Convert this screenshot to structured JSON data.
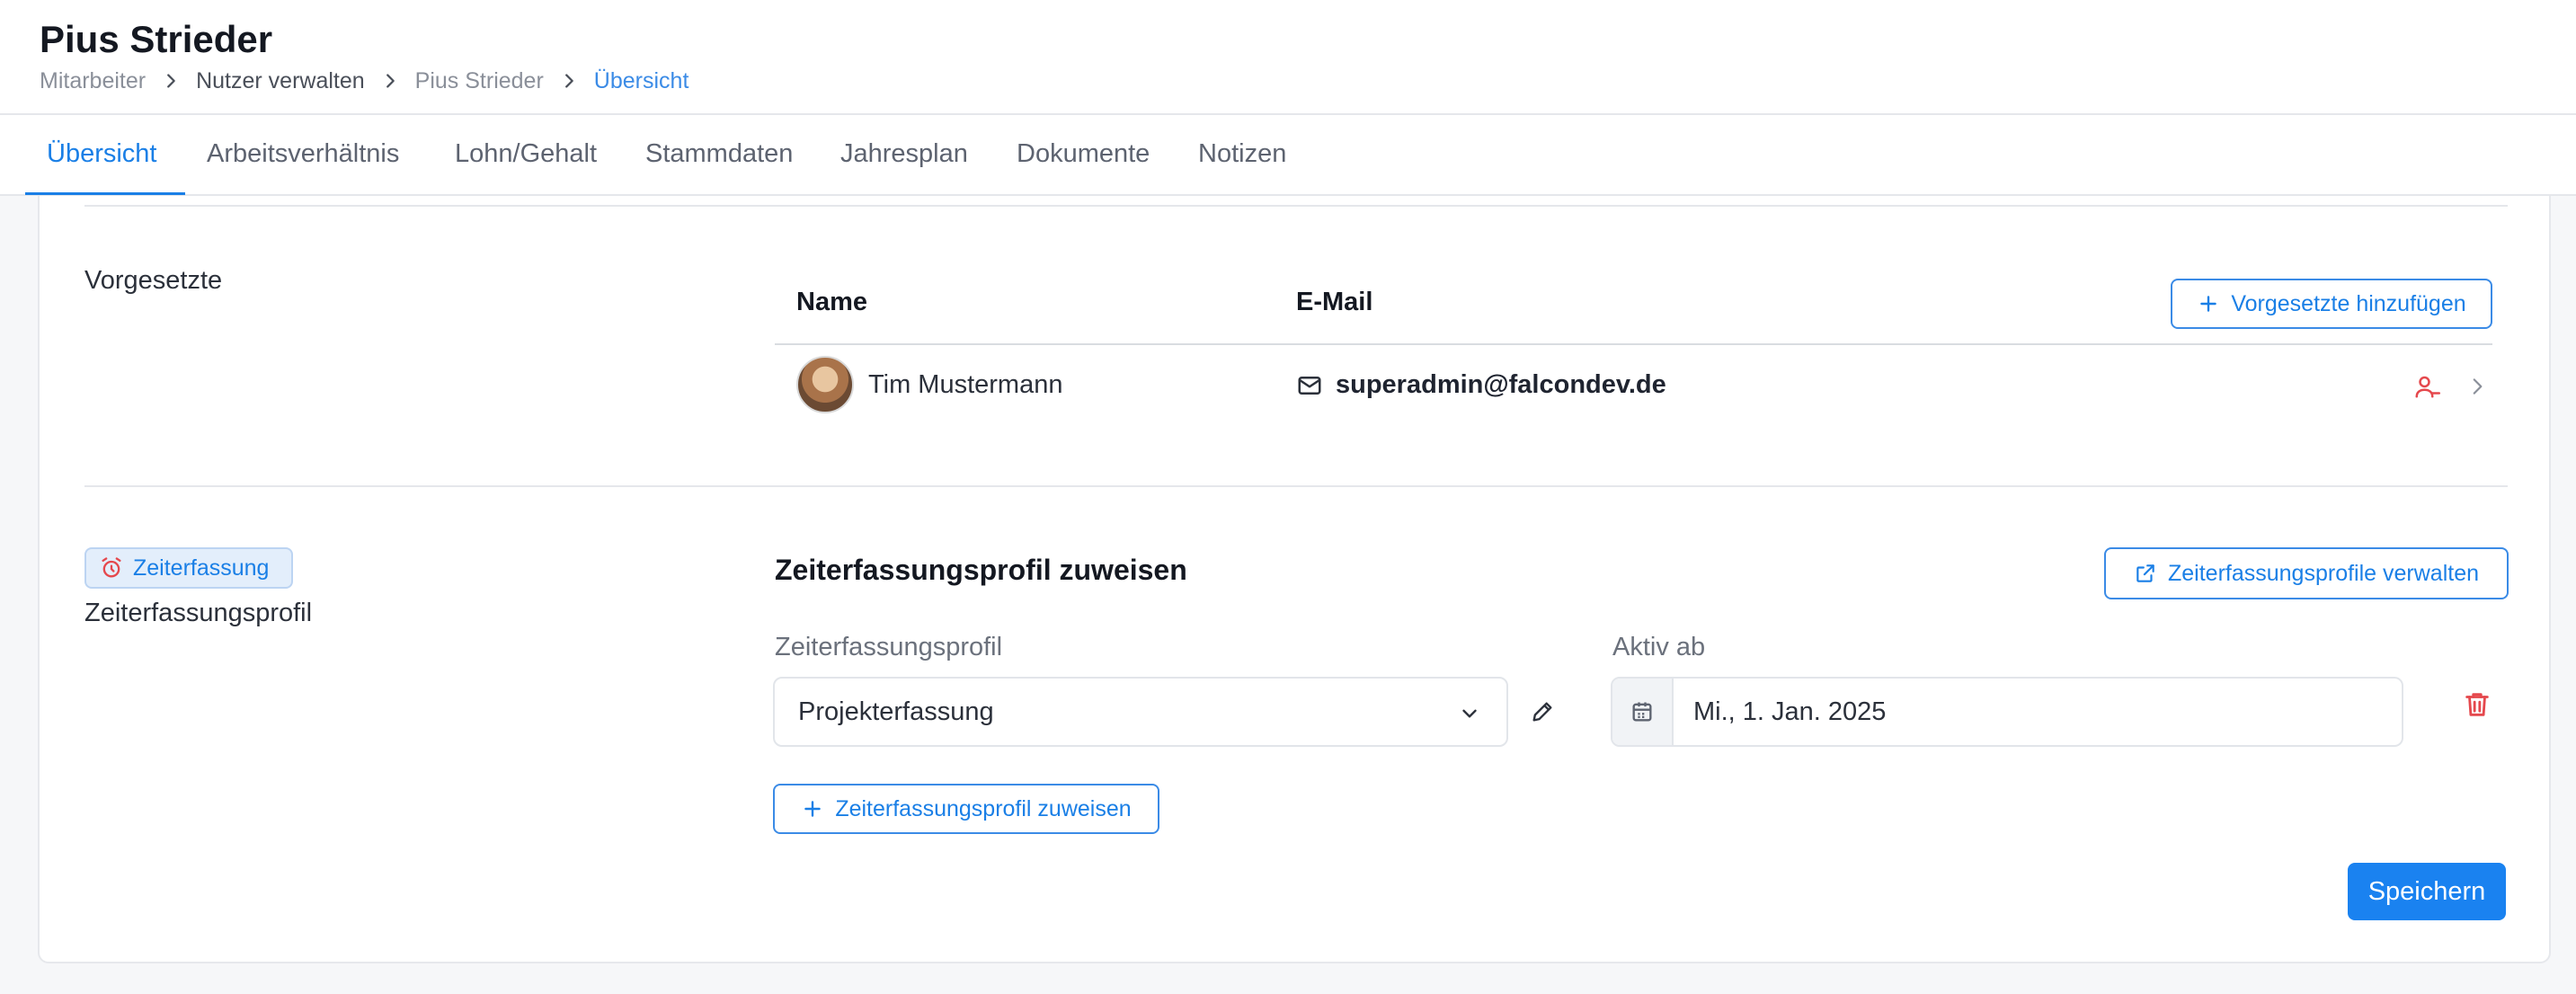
{
  "header": {
    "title": "Pius Strieder",
    "breadcrumb": [
      "Mitarbeiter",
      "Nutzer verwalten",
      "Pius Strieder",
      "Übersicht"
    ]
  },
  "tabs": [
    {
      "label": "Übersicht",
      "active": true
    },
    {
      "label": "Arbeitsverhältnis"
    },
    {
      "label": "Lohn/Gehalt"
    },
    {
      "label": "Stammdaten"
    },
    {
      "label": "Jahresplan"
    },
    {
      "label": "Dokumente"
    },
    {
      "label": "Notizen"
    }
  ],
  "supervisors": {
    "section_label": "Vorgesetzte",
    "columns": {
      "name": "Name",
      "email": "E-Mail"
    },
    "add_button": "Vorgesetzte hinzufügen",
    "rows": [
      {
        "name": "Tim Mustermann",
        "email": "superadmin@falcondev.de"
      }
    ]
  },
  "time_tracking": {
    "badge": "Zeiterfassung",
    "section_label": "Zeiterfassungsprofil",
    "title": "Zeiterfassungsprofil zuweisen",
    "manage_button": "Zeiterfassungsprofile verwalten",
    "profile_label": "Zeiterfassungsprofil",
    "profile_value": "Projekterfassung",
    "active_from_label": "Aktiv ab",
    "active_from_value": "Mi., 1. Jan. 2025",
    "assign_button": "Zeiterfassungsprofil zuweisen"
  },
  "save_button": "Speichern",
  "colors": {
    "accent": "#1a7fe6",
    "primary_button": "#1a82f0",
    "danger": "#e5484d"
  },
  "icons": [
    "chevron-right-icon",
    "plus-icon",
    "mail-icon",
    "user-minus-icon",
    "alarm-clock-icon",
    "external-link-icon",
    "chevron-down-icon",
    "pencil-icon",
    "calendar-icon",
    "trash-icon"
  ]
}
